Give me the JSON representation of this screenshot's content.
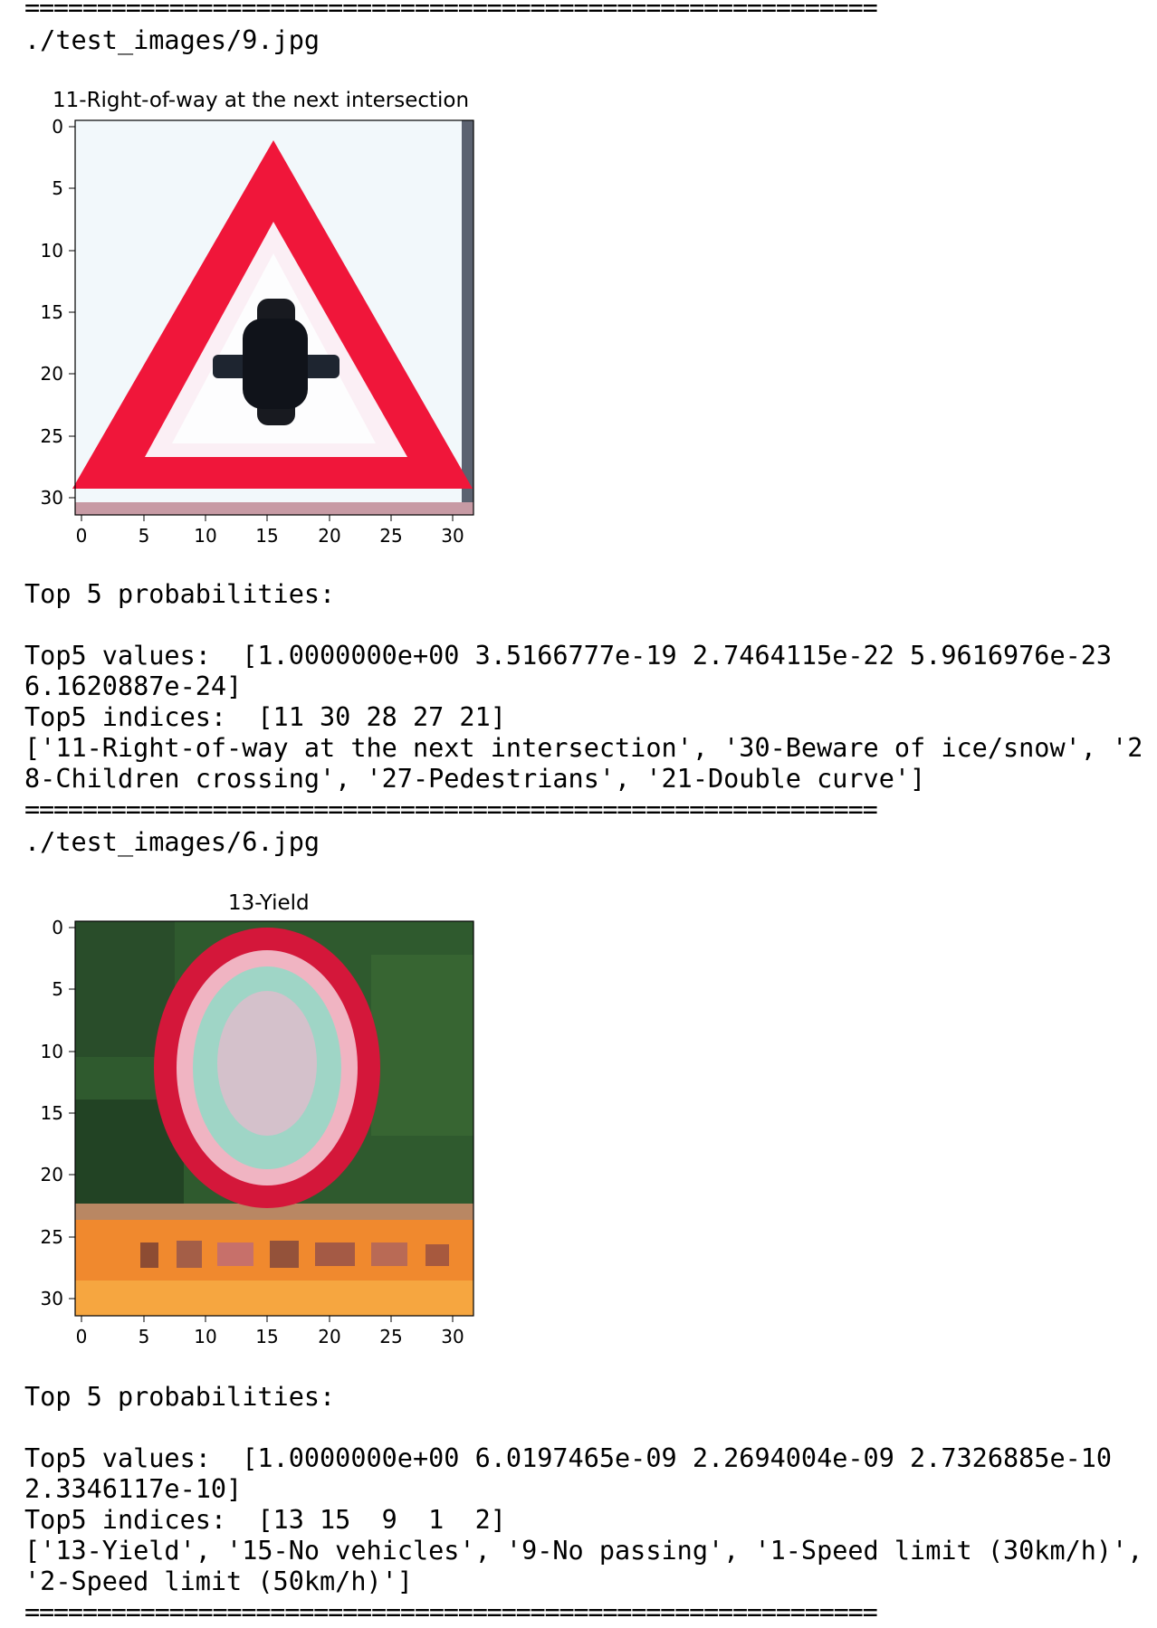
{
  "separator": "===========================================================",
  "blocks": [
    {
      "path": "./test_images/9.jpg",
      "plot_title": "11-Right-of-way at the next intersection",
      "x_ticks": [
        "0",
        "5",
        "10",
        "15",
        "20",
        "25",
        "30"
      ],
      "y_ticks": [
        "0",
        "5",
        "10",
        "15",
        "20",
        "25",
        "30"
      ],
      "image_description": "triangular red-bordered warning sign with black cross symbol",
      "top5_header": "Top 5 probabilities:",
      "top5_values_line1": "Top5 values:  [1.0000000e+00 3.5166777e-19 2.7464115e-22 5.9616976e-23",
      "top5_values_line2": "6.1620887e-24]",
      "top5_indices": "Top5 indices:  [11 30 28 27 21]",
      "labels_line1": "['11-Right-of-way at the next intersection', '30-Beware of ice/snow', '2",
      "labels_line2": "8-Children crossing', '27-Pedestrians', '21-Double curve']"
    },
    {
      "path": "./test_images/6.jpg",
      "plot_title": "13-Yield",
      "x_ticks": [
        "0",
        "5",
        "10",
        "15",
        "20",
        "25",
        "30"
      ],
      "y_ticks": [
        "0",
        "5",
        "10",
        "15",
        "20",
        "25",
        "30"
      ],
      "image_description": "round red-bordered sign over green foliage with orange bar below",
      "top5_header": "Top 5 probabilities:",
      "top5_values_line1": "Top5 values:  [1.0000000e+00 6.0197465e-09 2.2694004e-09 2.7326885e-10",
      "top5_values_line2": "2.3346117e-10]",
      "top5_indices": "Top5 indices:  [13 15  9  1  2]",
      "labels_line1": "['13-Yield', '15-No vehicles', '9-No passing', '1-Speed limit (30km/h)',",
      "labels_line2": "'2-Speed limit (50km/h)']"
    }
  ]
}
